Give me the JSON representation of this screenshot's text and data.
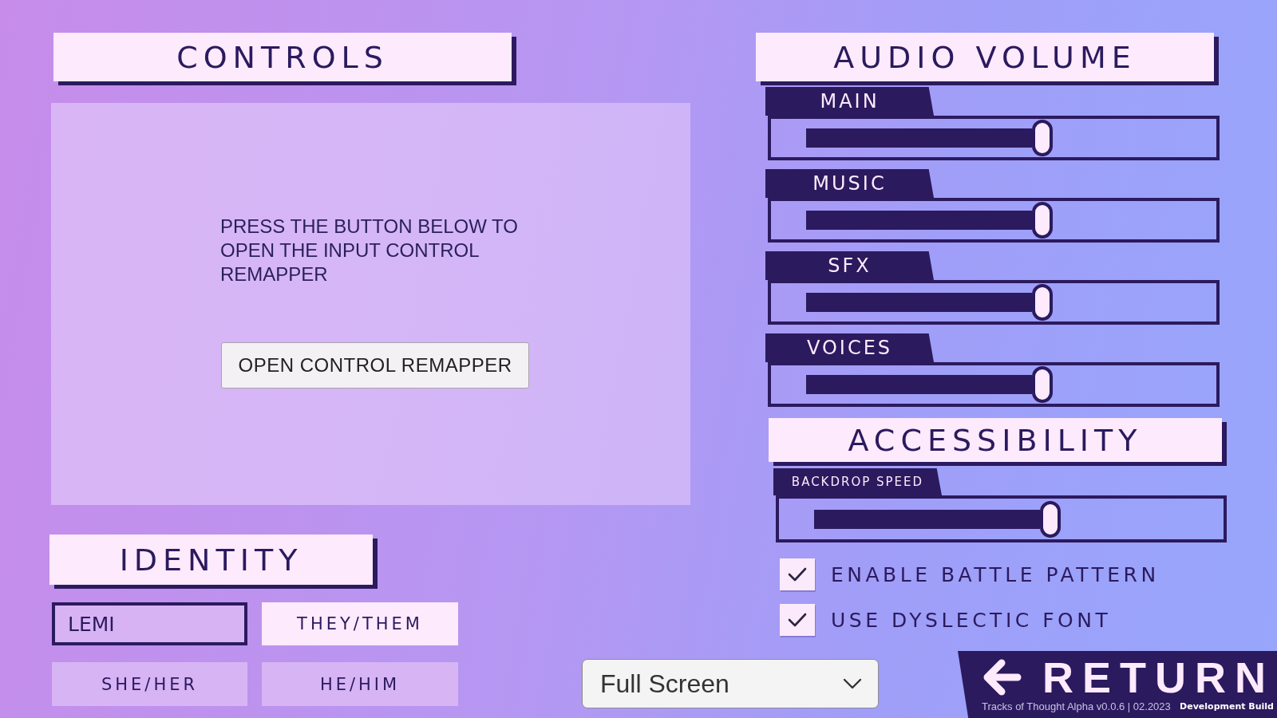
{
  "controls": {
    "title": "CONTROLS",
    "description": "PRESS THE BUTTON BELOW TO OPEN THE INPUT CONTROL REMAPPER",
    "button": "OPEN CONTROL REMAPPER"
  },
  "audio_volume": {
    "title": "AUDIO VOLUME",
    "sliders": [
      {
        "label": "MAIN",
        "level": 0.61
      },
      {
        "label": "MUSIC",
        "level": 0.61
      },
      {
        "label": "SFX",
        "level": 0.61
      },
      {
        "label": "VOICES",
        "level": 0.61
      }
    ]
  },
  "accessibility": {
    "title": "ACCESSIBILITY",
    "sliders": [
      {
        "label": "BACKDROP SPEED",
        "level": 0.61
      }
    ],
    "options": [
      {
        "label": "ENABLE BATTLE PATTERN",
        "checked": true
      },
      {
        "label": "USE DYSLECTIC FONT",
        "checked": true
      }
    ]
  },
  "identity": {
    "title": "IDENTITY",
    "name_field": {
      "value": "LEMI"
    },
    "pronouns": [
      {
        "label": "THEY/THEM",
        "selected": true
      },
      {
        "label": "SHE/HER",
        "selected": false
      },
      {
        "label": "HE/HIM",
        "selected": false
      }
    ]
  },
  "display_mode": {
    "value": "Full Screen"
  },
  "return_button": {
    "label": "RETURN"
  },
  "footer": {
    "version": "Tracks of Thought Alpha v0.0.6 | 02.2023",
    "build": "Development Build"
  }
}
